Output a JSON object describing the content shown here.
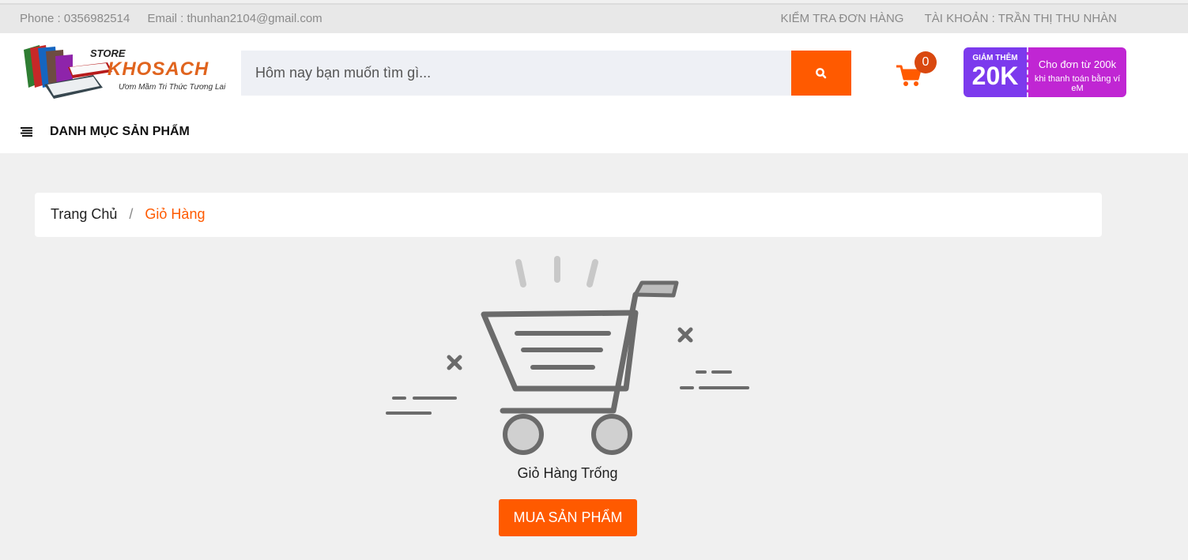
{
  "topbar": {
    "phone": "Phone : 0356982514",
    "email": "Email : thunhan2104@gmail.com",
    "check_order": "KIỂM TRA ĐƠN HÀNG",
    "account": "TÀI KHOẢN : TRẦN THỊ THU NHÀN"
  },
  "logo": {
    "store": "STORE",
    "name": "KHOSACH",
    "slogan": "Ươm Mầm Tri Thức Tương Lai"
  },
  "search": {
    "placeholder": "Hôm nay bạn muốn tìm gì...",
    "icon": "search-icon"
  },
  "cart": {
    "count": "0",
    "icon": "cart-icon",
    "color": "#ff5a00"
  },
  "promo": {
    "small": "GIẢM THÊM",
    "big": "20K",
    "line1": "Cho đơn từ 200k",
    "line2": "khi thanh toán bằng ví eM"
  },
  "menu": {
    "icon": "menu-icon",
    "label": "DANH MỤC SẢN PHẨM"
  },
  "breadcrumb": {
    "home": "Trang Chủ",
    "separator": "/",
    "current": "Giỏ Hàng"
  },
  "empty_cart": {
    "message": "Giỏ Hàng Trống",
    "button": "MUA SẢN PHẨM",
    "illustration": "empty-cart-illustration"
  },
  "colors": {
    "accent": "#ff5a00",
    "background": "#f0f0f0",
    "topbar": "#e8e8e8"
  }
}
